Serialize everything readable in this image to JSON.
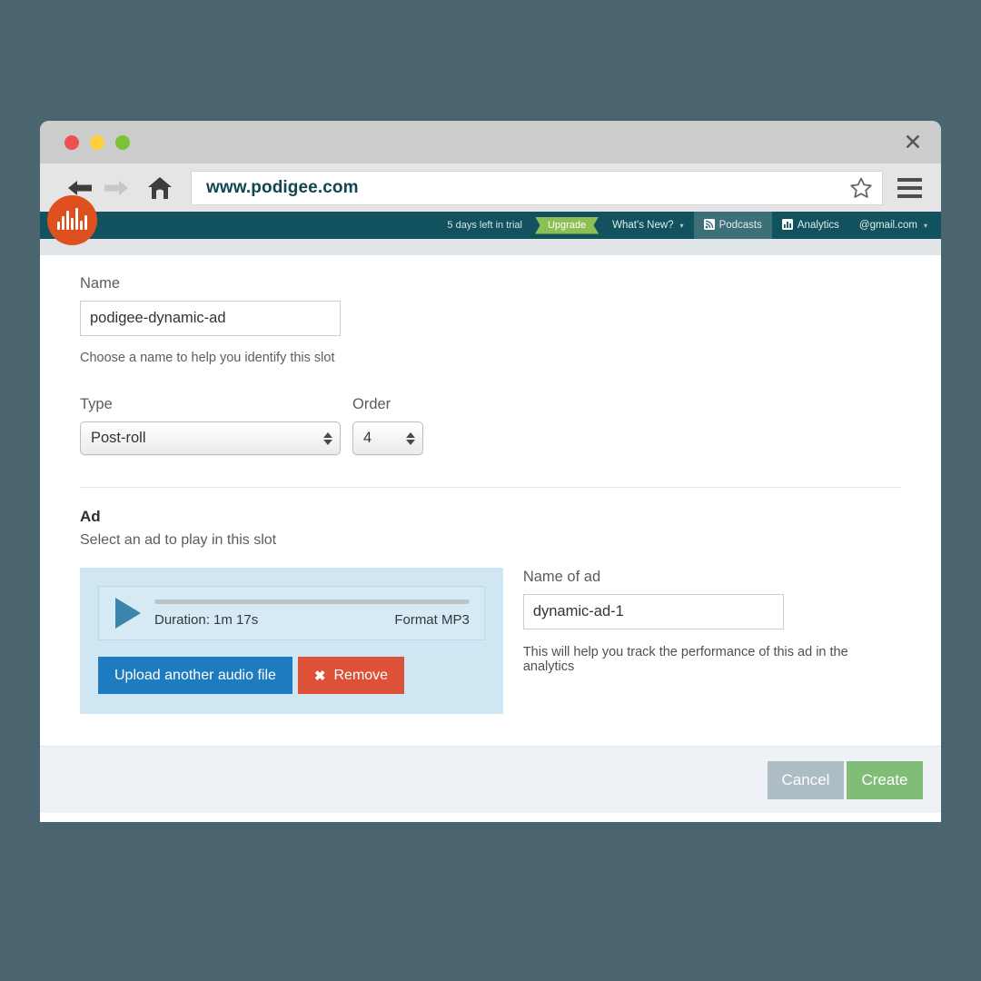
{
  "window": {
    "close_label": "✕",
    "traffic_lights": [
      "red",
      "yellow",
      "green"
    ]
  },
  "browser": {
    "url": "www.podigee.com",
    "back_icon": "back-arrow-icon",
    "forward_icon": "forward-arrow-icon",
    "home_icon": "home-icon",
    "bookmark_icon": "star-icon",
    "menu_icon": "hamburger-menu-icon"
  },
  "appnav": {
    "logo_name": "podigee-logo",
    "trial_text": "5 days left in trial",
    "upgrade_label": "Upgrade",
    "whats_new_label": "What's New?",
    "podcasts_label": "Podcasts",
    "analytics_label": "Analytics",
    "account_label": "@gmail.com",
    "caret": "▼"
  },
  "form": {
    "name_label": "Name",
    "name_value": "podigee-dynamic-ad",
    "name_placeholder": "Name",
    "name_help": "Choose a name to help you identify this slot",
    "type_label": "Type",
    "type_value": "Post-roll",
    "order_label": "Order",
    "order_value": "4"
  },
  "ad_section": {
    "title": "Ad",
    "subtitle": "Select an ad to play in this slot",
    "player": {
      "play_icon": "play-icon",
      "duration": "Duration: 1m 17s",
      "format": "Format MP3"
    },
    "upload_label": "Upload another audio file",
    "remove_label": "Remove",
    "remove_icon": "✖",
    "name_of_ad_label": "Name of ad",
    "name_of_ad_value": "dynamic-ad-1",
    "name_of_ad_placeholder": "Name of ad",
    "name_of_ad_note": "This will help you track the performance of this ad in the analytics"
  },
  "footer": {
    "cancel_label": "Cancel",
    "create_label": "Create"
  },
  "colors": {
    "page_background": "#4a6570",
    "nav_background": "#11525e",
    "brand_orange": "#df501f",
    "upgrade_green": "#8cc055",
    "upload_blue": "#1f7bbf",
    "remove_red": "#dc5138",
    "create_green": "#82bd78",
    "cancel_gray": "#aebcc4",
    "ad_panel_blue": "#cfe7f2",
    "url_text": "#104551"
  }
}
